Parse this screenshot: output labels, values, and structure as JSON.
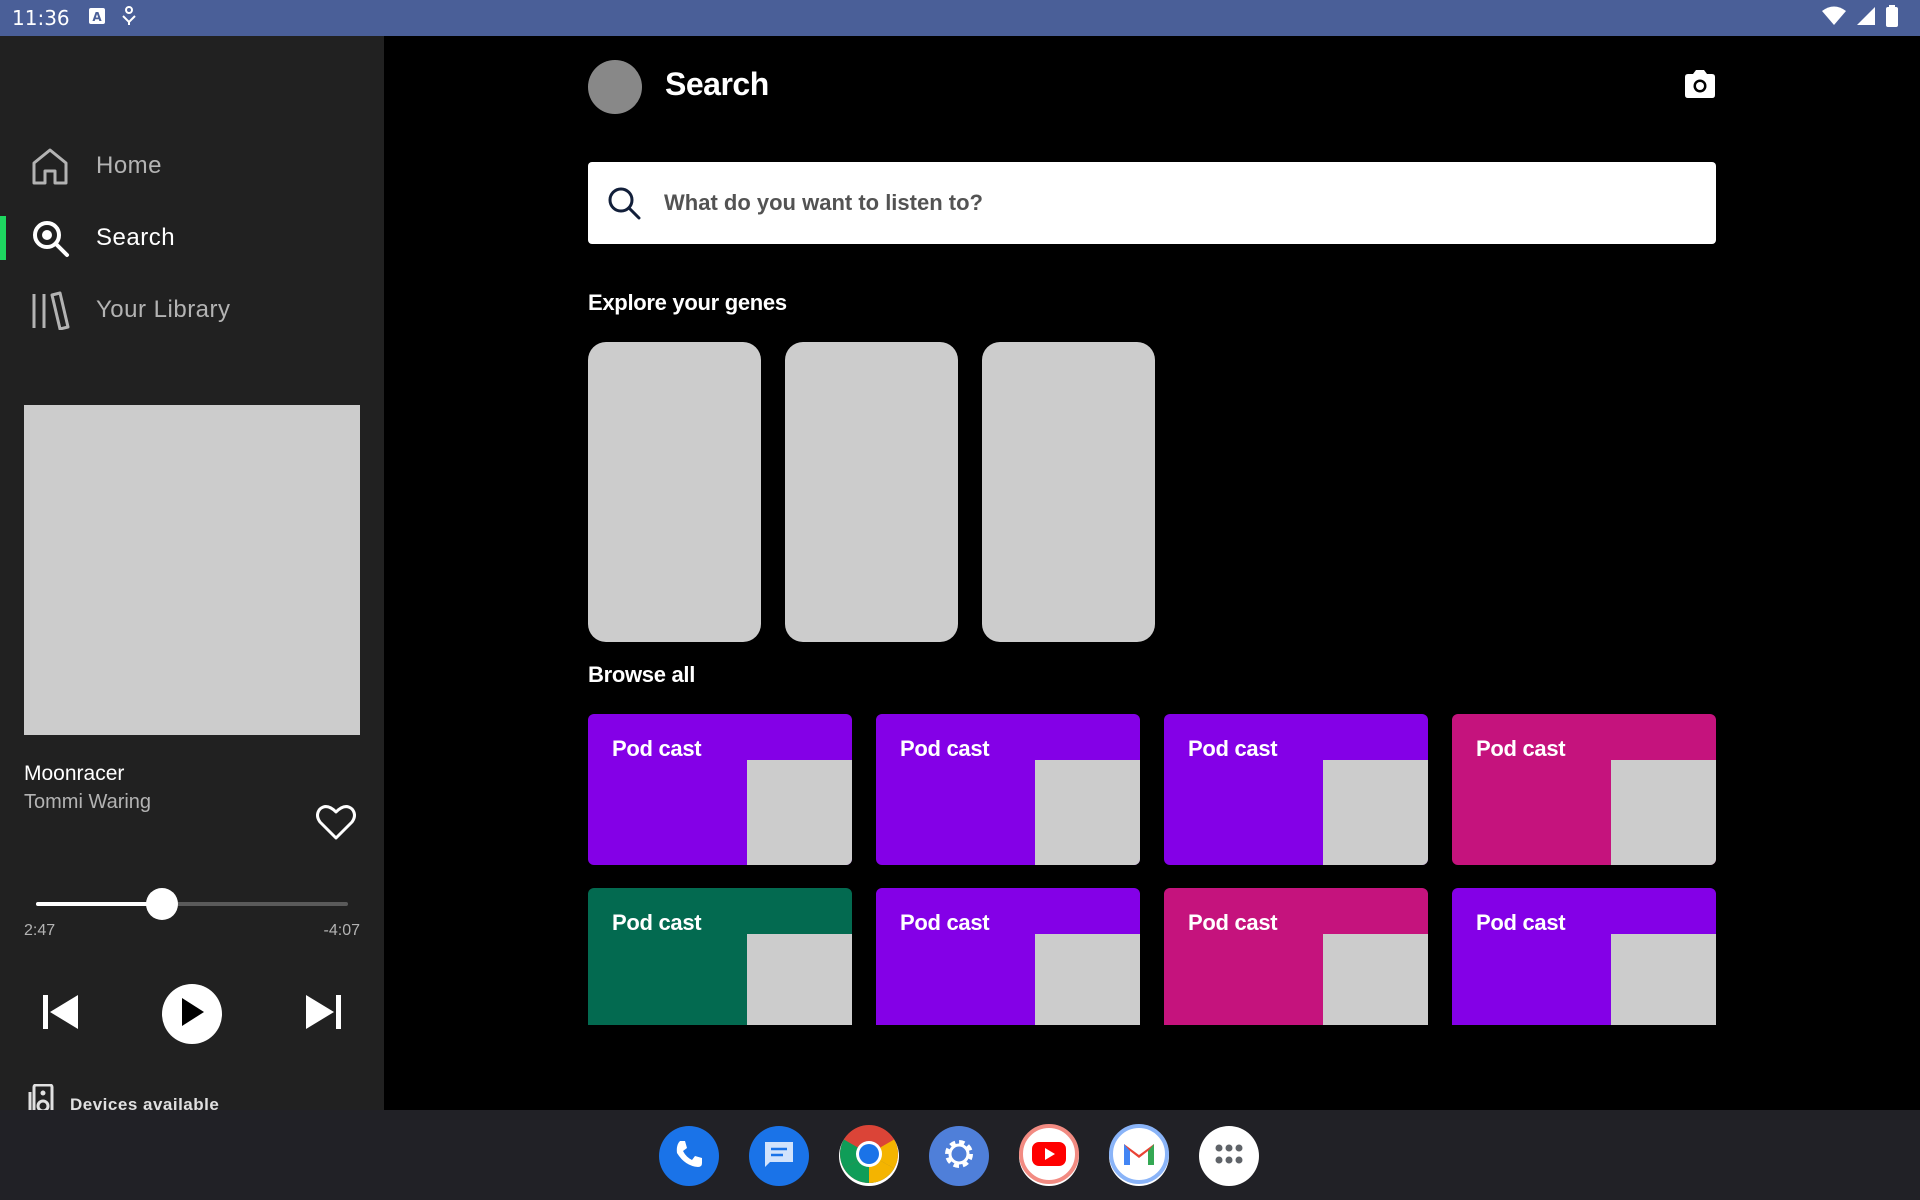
{
  "status_bar": {
    "time": "11:36"
  },
  "sidebar": {
    "nav": [
      {
        "label": "Home",
        "icon": "home-icon",
        "active": false
      },
      {
        "label": "Search",
        "icon": "search-icon",
        "active": true
      },
      {
        "label": "Your Library",
        "icon": "library-icon",
        "active": false
      }
    ],
    "now_playing": {
      "title": "Moonracer",
      "artist": "Tommi Waring",
      "elapsed": "2:47",
      "remaining": "-4:07",
      "progress_fraction": 0.405
    },
    "devices_label": "Devices available"
  },
  "main": {
    "title": "Search",
    "search": {
      "placeholder": "What do you want to listen to?"
    },
    "explore_title": "Explore your genes",
    "browse_title": "Browse all",
    "browse_cards": [
      {
        "label": "Pod cast",
        "color": "#8400e7"
      },
      {
        "label": "Pod cast",
        "color": "#8400e7"
      },
      {
        "label": "Pod cast",
        "color": "#8400e7"
      },
      {
        "label": "Pod cast",
        "color": "#c5137d"
      },
      {
        "label": "Pod cast",
        "color": "#036a50"
      },
      {
        "label": "Pod cast",
        "color": "#8400e7"
      },
      {
        "label": "Pod cast",
        "color": "#c5137d"
      },
      {
        "label": "Pod cast",
        "color": "#8400e7"
      }
    ]
  },
  "colors": {
    "accent": "#1ed760",
    "sidebar_bg": "#212121",
    "status_bar_bg": "#4a5f98"
  },
  "dock": [
    "phone-icon",
    "messages-icon",
    "chrome-icon",
    "settings-icon",
    "youtube-icon",
    "gmail-icon",
    "app-drawer-icon"
  ]
}
